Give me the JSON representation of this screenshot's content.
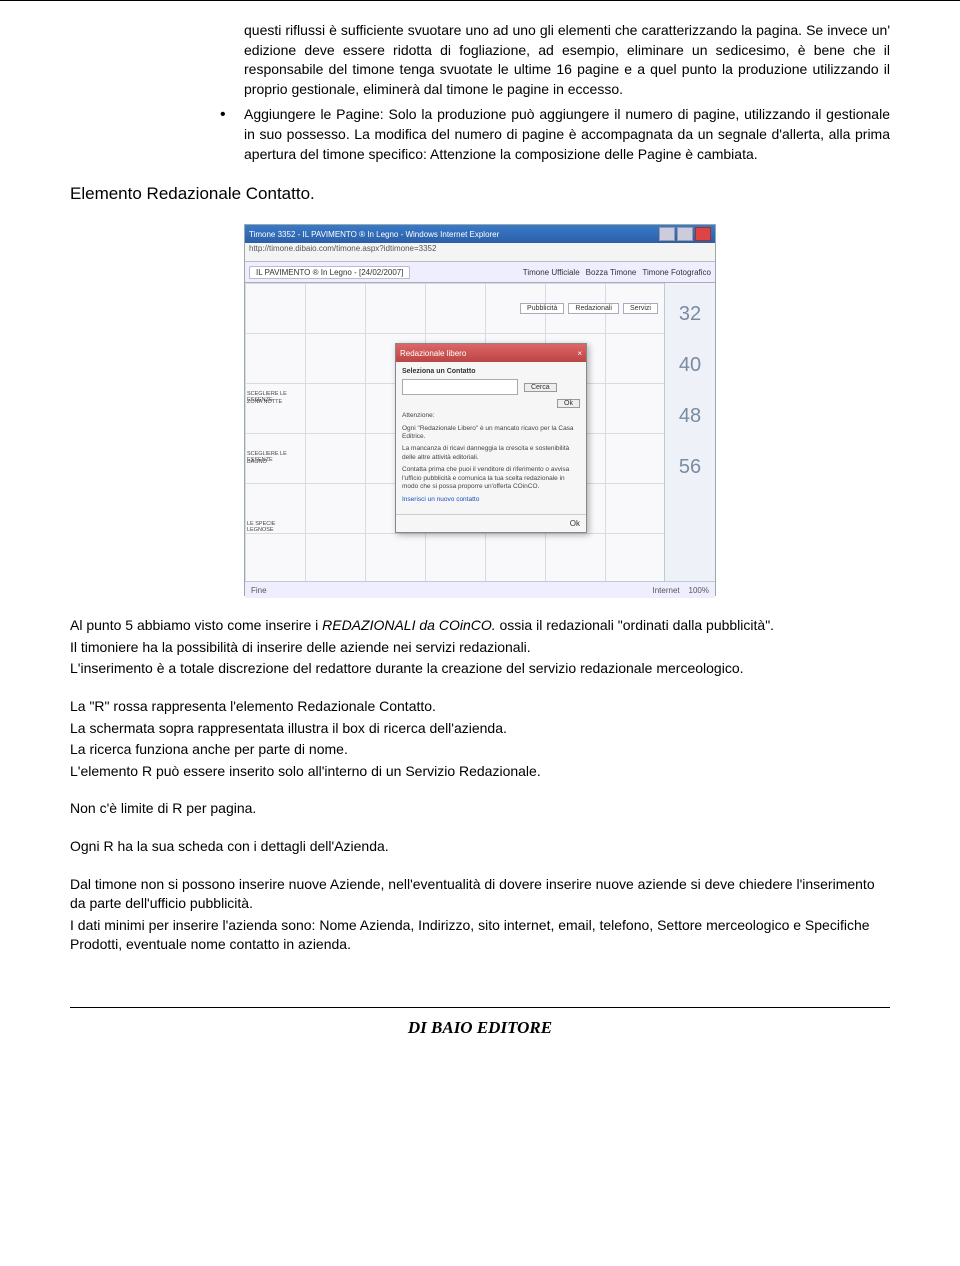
{
  "bullets": {
    "b1": "questi riflussi è sufficiente svuotare uno ad uno gli elementi che caratterizzando la pagina. Se invece un' edizione deve essere ridotta di fogliazione, ad esempio, eliminare un sedicesimo, è bene che il responsabile del timone tenga svuotate le ultime 16 pagine e a quel punto la produzione utilizzando il proprio gestionale, eliminerà dal timone le pagine in eccesso.",
    "b2": "Aggiungere le Pagine: Solo la produzione può aggiungere il numero di pagine, utilizzando il gestionale in suo possesso. La modifica del numero di pagine è accompagnata da un segnale d'allerta, alla prima apertura del timone specifico: Attenzione la composizione delle Pagine è cambiata."
  },
  "heading": "Elemento Redazionale Contatto.",
  "screenshot": {
    "window_title": "Timone 3352 - IL PAVIMENTO ® In Legno - Windows Internet Explorer",
    "address": "http://timone.dibaio.com/timone.aspx?idtimone=3352",
    "tab_label": "IL PAVIMENTO ® In Legno - [24/02/2007]",
    "top_tabs": {
      "t1": "Timone Ufficiale",
      "t2": "Bozza Timone",
      "t3": "Timone Fotografico"
    },
    "side_buttons": {
      "s1": "Pubblicità",
      "s2": "Redazionali",
      "s3": "Servizi"
    },
    "side_numbers": [
      "32",
      "40",
      "48",
      "56"
    ],
    "grid_labels": {
      "g1": "SCEGLIERE LE ESSENZE",
      "g2": "ZONA NOTTE",
      "g3": "SCEGLIERE LE ESSENZE",
      "g4": "BAGNO",
      "g5": "LE SPECIE LEGNOSE"
    },
    "dialog": {
      "title": "Redazionale libero",
      "label_seleziona": "Seleziona un Contatto",
      "btn_cerca": "Cerca",
      "btn_ok": "Ok",
      "attenzione": "Attenzione:",
      "line1": "Ogni \"Redazionale Libero\" è un mancato ricavo per la Casa Editrice.",
      "line2": "La mancanza di ricavi danneggia la crescita e sostenibilità delle altre attività editoriali.",
      "line3": "Contatta prima che puoi il venditore di riferimento o avvisa l'ufficio pubblicità e comunica la tua scelta redazionale in modo che si possa proporre un'offerta COinCO.",
      "link": "Inserisci un nuovo contatto",
      "btn_ok2": "Ok"
    },
    "status_left": "Fine",
    "status_right_net": "Internet",
    "status_right_zoom": "100%"
  },
  "body": {
    "p1a": "Al punto 5 abbiamo visto come inserire i ",
    "p1b": "REDAZIONALI da COinCO.",
    "p1c": " ossia il redazionali \"ordinati dalla pubblicità\".",
    "p2": "Il timoniere ha la possibilità di inserire delle aziende nei servizi redazionali.",
    "p3": "L'inserimento è a totale discrezione del redattore durante la creazione del servizio redazionale merceologico.",
    "p4": "La \"R\" rossa  rappresenta l'elemento Redazionale Contatto.",
    "p5": "La schermata sopra rappresentata illustra il box di ricerca dell'azienda.",
    "p6": "La ricerca funziona anche per parte di nome.",
    "p7": "L'elemento R può essere inserito solo all'interno di un Servizio Redazionale.",
    "p8": "Non c'è limite di R per pagina.",
    "p9": "Ogni R ha la sua scheda con i dettagli dell'Azienda.",
    "p10": "Dal timone non si possono inserire nuove Aziende, nell'eventualità di dovere inserire nuove aziende si deve chiedere l'inserimento da parte dell'ufficio pubblicità.",
    "p11": "I dati minimi per inserire l'azienda sono: Nome Azienda, Indirizzo, sito internet, email, telefono, Settore merceologico e Specifiche Prodotti, eventuale nome contatto in azienda."
  },
  "footer": "DI BAIO EDITORE"
}
